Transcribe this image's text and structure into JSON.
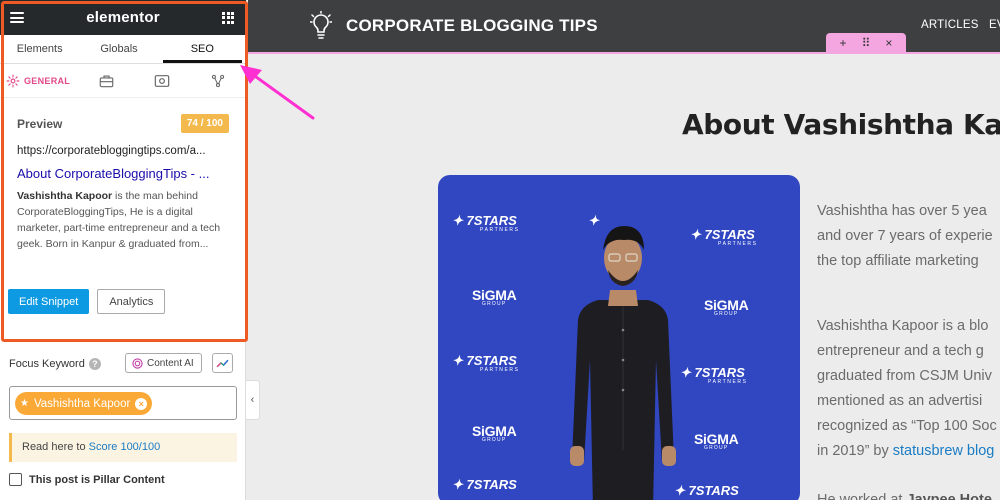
{
  "editor": {
    "brand": "elementor",
    "tabs": [
      "Elements",
      "Globals",
      "SEO"
    ],
    "active_tab": "SEO",
    "general_label": "GENERAL",
    "preview": {
      "title": "Preview",
      "score": "74 / 100",
      "url": "https://corporatebloggingtips.com/a...",
      "seo_title": "About CorporateBloggingTips - ...",
      "desc_bold": "Vashishtha Kapoor",
      "desc_rest": " is the man behind CorporateBloggingTips, He is a digital marketer, part-time entrepreneur and a tech geek. Born in Kanpur & graduated from...",
      "edit_snippet": "Edit Snippet",
      "analytics": "Analytics"
    },
    "focus_keyword": {
      "label": "Focus Keyword",
      "help": "?",
      "content_ai": "Content AI",
      "keyword": "Vashishtha Kapoor"
    },
    "notice": {
      "prefix": "Read here to ",
      "link": "Score 100/100"
    },
    "pillar_label": "This post is Pillar Content",
    "collapse_icon": "‹"
  },
  "site": {
    "name": "CORPORATE BLOGGING TIPS",
    "nav": [
      "ARTICLES",
      "EV"
    ],
    "handle": [
      "+",
      "⠿",
      "×"
    ],
    "page_title": "About Vashishtha Kap",
    "photo": {
      "logos": [
        "7STARS",
        "SiGMA"
      ],
      "logo_subs": [
        "PARTNERS",
        "GROUP"
      ]
    },
    "paragraphs": [
      [
        "Vashishtha has over 5 yea",
        "and over 7 years of experie",
        "the top affiliate marketing"
      ],
      [
        "Vashishtha Kapoor is a blo",
        "entrepreneur and a tech g",
        "graduated from CSJM Univ",
        "mentioned as an advertisi",
        "recognized as “Top 100 Soc"
      ],
      [
        "in 2019” by ",
        "statusbrew blog"
      ],
      [
        "He worked at ",
        "Jaypee Hote"
      ]
    ]
  },
  "colors": {
    "editor_dark": "#26292c",
    "accent_pink": "#e2498a",
    "highlight_orange": "#ee5a24",
    "score_badge": "#f3b94d",
    "primary_button": "#0e9ae2",
    "keyword_chip": "#fba936",
    "site_header": "#3e3f41",
    "photo_wall": "#3147c2",
    "arrow": "#ff2fd1"
  }
}
